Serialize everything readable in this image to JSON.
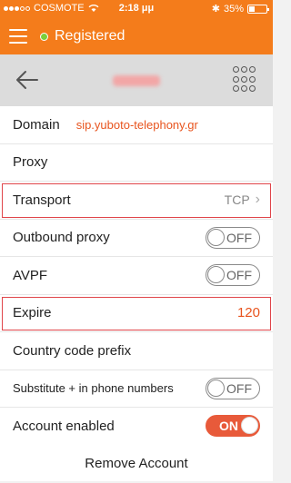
{
  "statusbar": {
    "carrier": "COSMOTE",
    "time": "2:18 μμ",
    "battery": "35%",
    "battery_level": 0.35
  },
  "appbar": {
    "status": "Registered"
  },
  "rows": {
    "domain": {
      "label": "Domain",
      "value": "sip.yuboto-telephony.gr"
    },
    "proxy": {
      "label": "Proxy"
    },
    "transport": {
      "label": "Transport",
      "value": "TCP"
    },
    "outbound": {
      "label": "Outbound proxy",
      "toggle": "OFF"
    },
    "avpf": {
      "label": "AVPF",
      "toggle": "OFF"
    },
    "expire": {
      "label": "Expire",
      "value": "120"
    },
    "country": {
      "label": "Country code prefix"
    },
    "substitute": {
      "label": "Substitute + in phone numbers",
      "toggle": "OFF"
    },
    "enabled": {
      "label": "Account enabled",
      "toggle": "ON"
    }
  },
  "remove_label": "Remove Account"
}
